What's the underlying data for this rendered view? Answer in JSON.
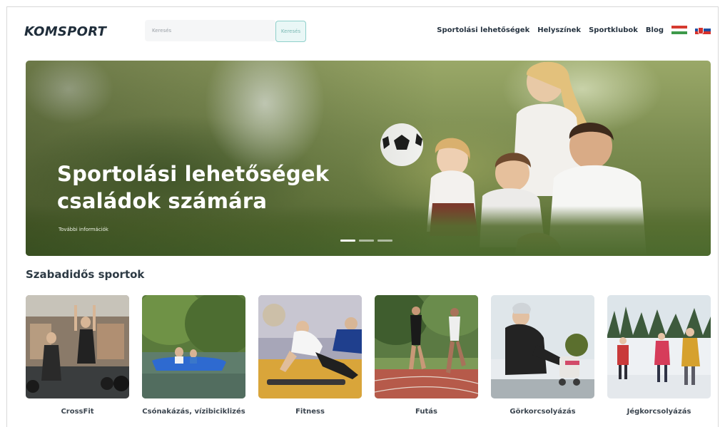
{
  "header": {
    "logo": "KOMSPORT",
    "search": {
      "placeholder": "Keresés",
      "button_label": "Keresés"
    },
    "nav": [
      {
        "label": "Sportolási lehetőségek"
      },
      {
        "label": "Helyszínek"
      },
      {
        "label": "Sportklubok"
      },
      {
        "label": "Blog"
      }
    ],
    "languages": [
      {
        "code": "hu",
        "icon": "hungary-flag-icon"
      },
      {
        "code": "sk",
        "icon": "slovakia-flag-icon"
      }
    ]
  },
  "hero": {
    "title": "Sportolási lehetőségek családok számára",
    "link_label": "További információk",
    "slides": {
      "count": 3,
      "active": 1
    }
  },
  "section": {
    "title": "Szabadidős sportok",
    "cards": [
      {
        "label": "CrossFit",
        "image": "crossfit-photo"
      },
      {
        "label": "Csónakázás, vízibiciklizés",
        "image": "boating-photo"
      },
      {
        "label": "Fitness",
        "image": "fitness-photo"
      },
      {
        "label": "Futás",
        "image": "running-photo"
      },
      {
        "label": "Görkorcsolyázás",
        "image": "rollerskating-photo"
      },
      {
        "label": "Jégkorcsolyázás",
        "image": "iceskating-photo"
      }
    ]
  },
  "colors": {
    "accent": "#8fd0cb",
    "text_dark": "#263340",
    "logo": "#1f2d3a"
  }
}
